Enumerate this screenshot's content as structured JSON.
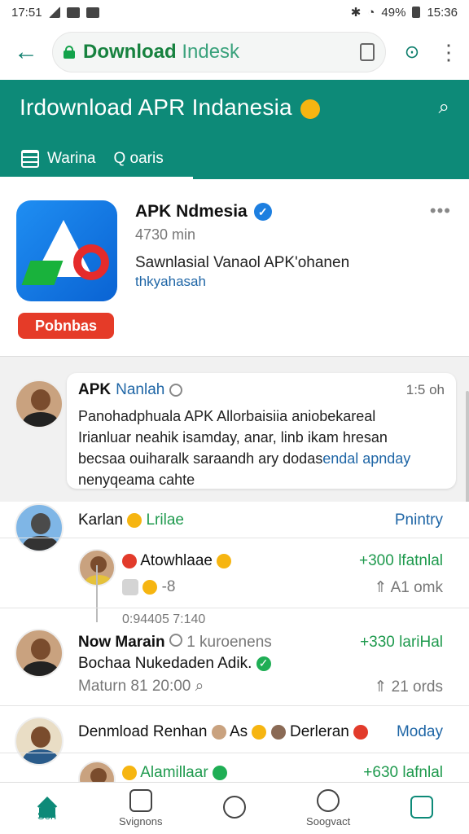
{
  "status_bar": {
    "time": "17:51",
    "battery_pct": "49%",
    "battery_time": "15:36"
  },
  "browser": {
    "url_bold": "Download",
    "url_light": "Indesk"
  },
  "header": {
    "title": "Irdownload APR Indanesia",
    "tabs": [
      {
        "label": "Warina"
      },
      {
        "label": "Q oaris"
      }
    ]
  },
  "app": {
    "name": "APK Ndmesia",
    "meta": "4730 min",
    "description": "Sawnlasial Vanaol APK'ohanen",
    "subdescription": "thkyahasah",
    "badge": "Pobnbas"
  },
  "post": {
    "author": "APK",
    "author2": "Nanlah",
    "time": "1:5 oh",
    "line1": "Panohadphuala APK Allorbaisiia aniobekareal",
    "line2": "Irianluar neahik isamday, anar, linb ikam hresan",
    "line3a": "becsaa ouiharalk saraandh ary dodas",
    "line3b": "endal apnday",
    "line4": "nenyqeama cahte"
  },
  "comments": [
    {
      "name": "Karlan",
      "tag": "Lrilae",
      "action": "Pnintry"
    },
    {
      "name": "Atowhlaae",
      "score": "+300 lfatnlal",
      "meta": "-8",
      "rank": "A1 omk"
    },
    {
      "stamp": "0:94405 7:140"
    },
    {
      "name": "Now Marain",
      "count": "1 kuroenens",
      "score": "+330 lariHal",
      "sub": "Bochaa Nukedaden Adik.",
      "date": "Maturn 81 20:00",
      "rank": "21 ords"
    },
    {
      "name": "Denmload Renhan",
      "mid": "As",
      "tail": "Derleran",
      "action": "Moday"
    },
    {
      "name": "Alamillaar",
      "score": "+630 lafnlal"
    }
  ],
  "bottom_nav": [
    {
      "label": "Sen"
    },
    {
      "label": "Svignons"
    },
    {
      "label": ""
    },
    {
      "label": "Soogvact"
    },
    {
      "label": ""
    }
  ]
}
